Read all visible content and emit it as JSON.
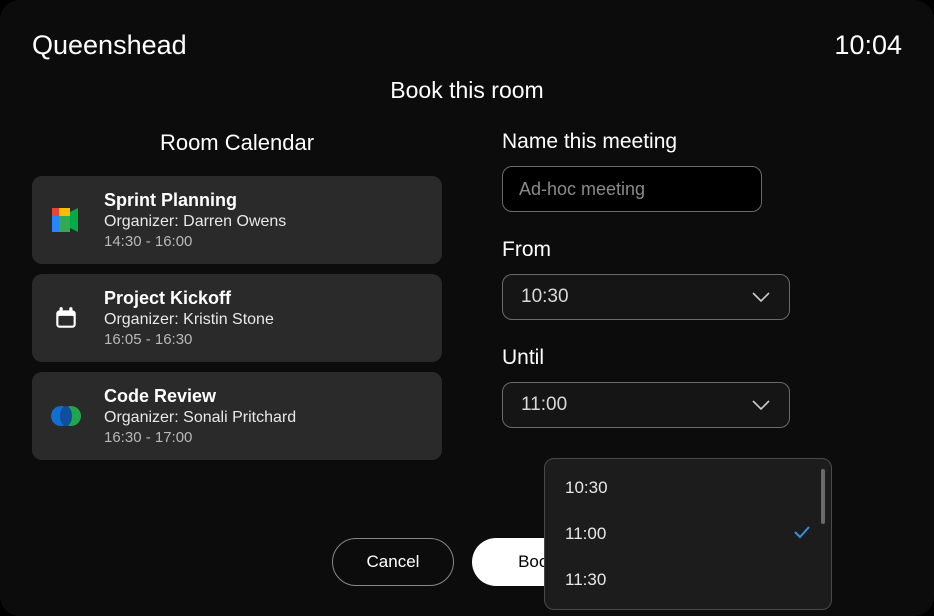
{
  "header": {
    "room_name": "Queenshead",
    "clock": "10:04"
  },
  "page_title": "Book this room",
  "calendar": {
    "heading": "Room Calendar",
    "events": [
      {
        "title": "Sprint Planning",
        "organizer": "Organizer: Darren Owens",
        "time": "14:30 - 16:00",
        "icon": "google-meet-icon"
      },
      {
        "title": "Project Kickoff",
        "organizer": "Organizer: Kristin Stone",
        "time": "16:05 - 16:30",
        "icon": "calendar-icon"
      },
      {
        "title": "Code Review",
        "organizer": "Organizer: Sonali Pritchard",
        "time": "16:30 - 17:00",
        "icon": "webex-icon"
      }
    ]
  },
  "form": {
    "name_label": "Name this meeting",
    "name_placeholder": "Ad-hoc meeting",
    "name_value": "",
    "from_label": "From",
    "from_value": "10:30",
    "until_label": "Until",
    "until_value": "11:00",
    "until_options": [
      {
        "label": "10:30",
        "selected": false
      },
      {
        "label": "11:00",
        "selected": true
      },
      {
        "label": "11:30",
        "selected": false
      }
    ]
  },
  "buttons": {
    "cancel": "Cancel",
    "book": "Book"
  }
}
